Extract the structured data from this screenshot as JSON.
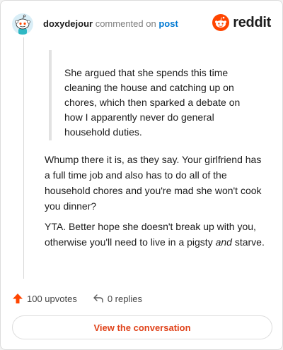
{
  "comment": {
    "username": "doxydejour",
    "action_text": "commented on",
    "post_link": "post",
    "quote": "She argued that she spends this time cleaning the house and catching up on chores, which then sparked a debate on how I apparently never do general household duties.",
    "paragraph1": "Whump there it is, as they say. Your girlfriend has a full time job and also has to do all of the household chores and you're mad she won't cook you dinner?",
    "paragraph2_before": "YTA. Better hope she doesn't break up with you, otherwise you'll need to live in a pigsty ",
    "paragraph2_emph": "and",
    "paragraph2_after": " starve."
  },
  "brand": {
    "name": "reddit",
    "icon": "reddit-snoo-icon",
    "color": "#ff4500"
  },
  "actions": {
    "upvotes": "100 upvotes",
    "upvote_icon": "upvote-arrow-icon",
    "replies": "0 replies",
    "reply_icon": "reply-arrow-icon"
  },
  "cta": {
    "label": "View the conversation"
  },
  "colors": {
    "accent": "#ff4500",
    "link": "#0079d3",
    "cta_text": "#e0431b"
  }
}
